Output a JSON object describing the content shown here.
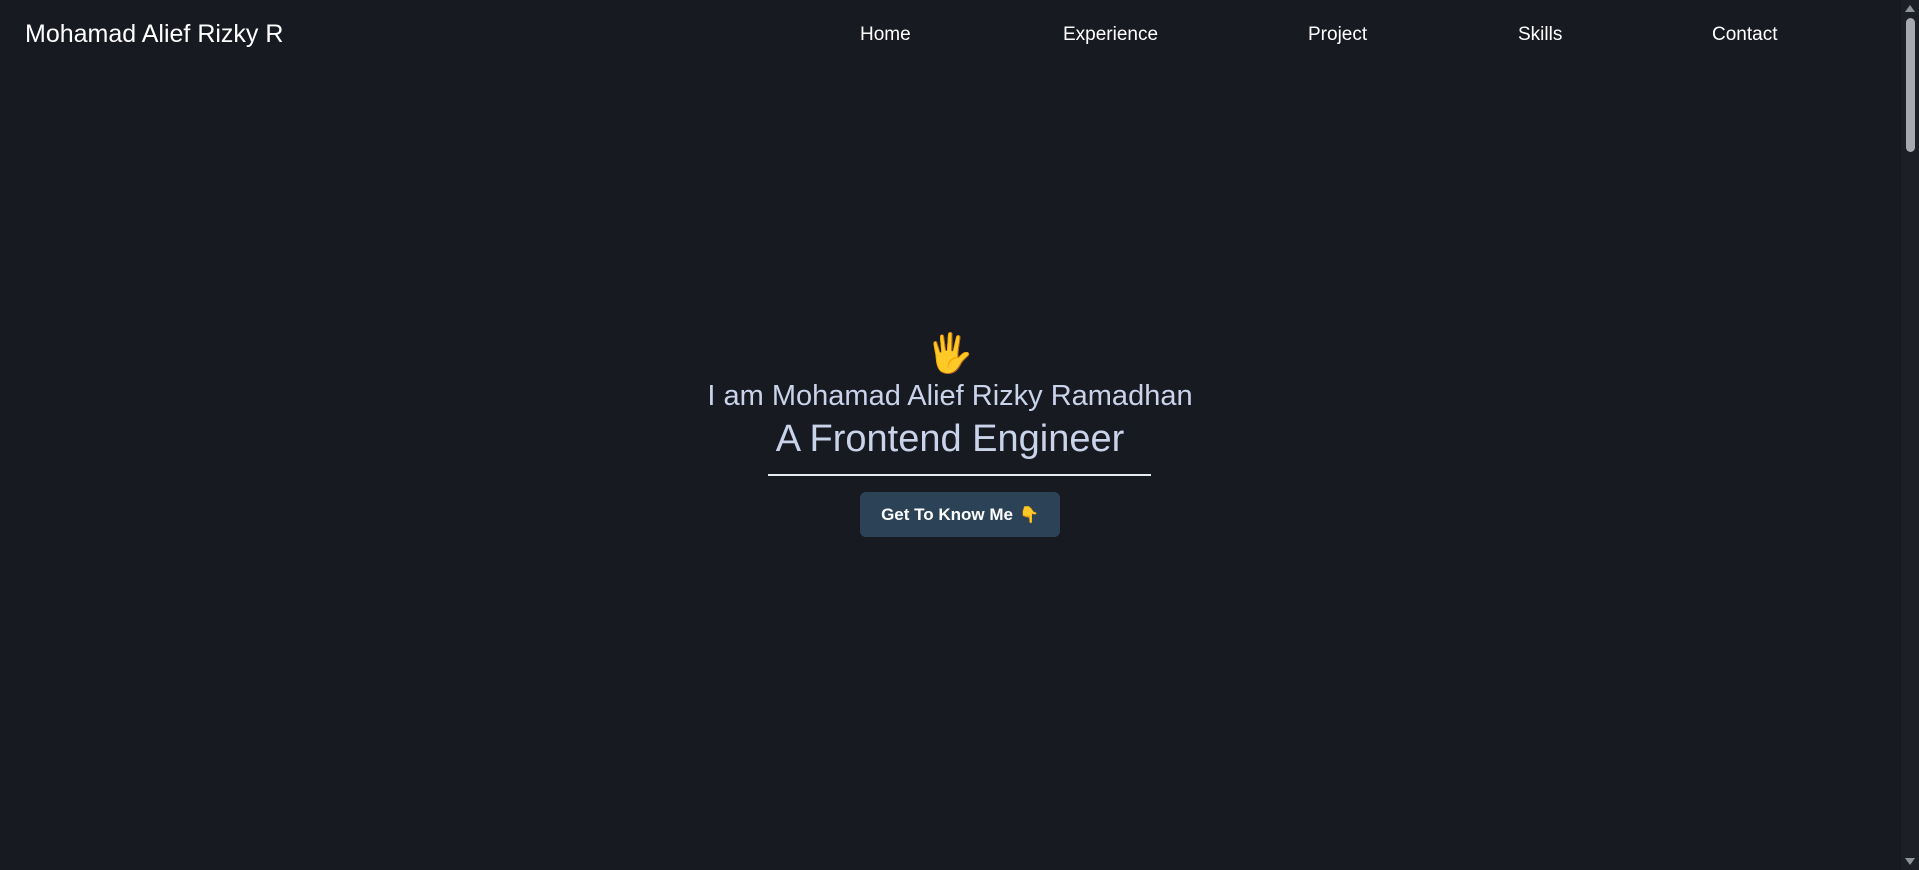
{
  "header": {
    "brand": "Mohamad Alief Rizky R",
    "nav": {
      "home": "Home",
      "experience": "Experience",
      "project": "Project",
      "skills": "Skills",
      "contact": "Contact"
    }
  },
  "hero": {
    "wave_emoji": "🖐️",
    "intro": "I am Mohamad Alief Rizky Ramadhan",
    "role": "A Frontend Engineer",
    "cta_label": "Get To Know Me",
    "cta_emoji": "👇"
  },
  "colors": {
    "background": "#181a21",
    "text": "#ffffff",
    "hero_text": "#c9d3ea",
    "button": "#2c4357"
  }
}
